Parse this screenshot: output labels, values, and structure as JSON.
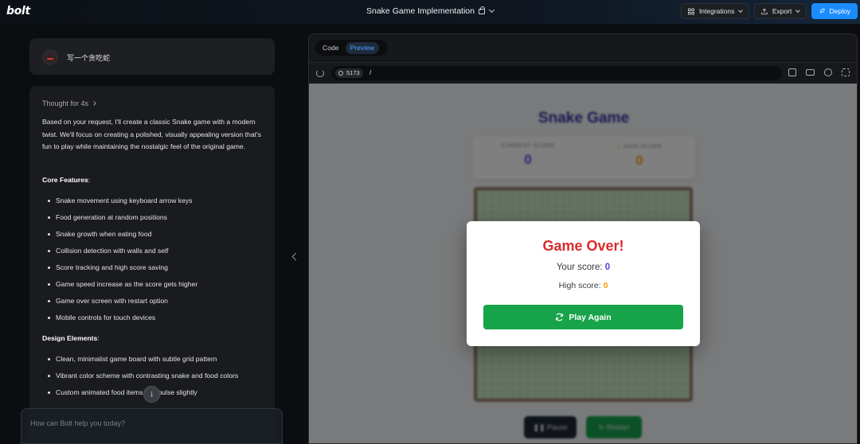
{
  "topbar": {
    "logo": "bolt",
    "project_title": "Snake Game Implementation",
    "integrations_label": "Integrations",
    "export_label": "Export",
    "deploy_label": "Deploy"
  },
  "chat": {
    "user_message": "写一个贪吃蛇",
    "thought_label": "Thought for 4s",
    "intro": "Based on your request, I'll create a classic Snake game with a modern twist. We'll focus on creating a polished, visually appealing version that's fun to play while maintaining the nostalgic feel of the original game.",
    "core_heading": "Core Features",
    "core_features": [
      "Snake movement using keyboard arrow keys",
      "Food generation at random positions",
      "Snake growth when eating food",
      "Collision detection with walls and self",
      "Score tracking and high score saving",
      "Game speed increase as the score gets higher",
      "Game over screen with restart option",
      "Mobile controls for touch devices"
    ],
    "design_heading": "Design Elements",
    "design_elements": [
      "Clean, minimalist game board with subtle grid pattern",
      "Vibrant color scheme with contrasting snake and food colors",
      "Custom animated food items that pulse slightly"
    ],
    "input_placeholder": "How can Bolt help you today?"
  },
  "preview": {
    "tabs": [
      "Code",
      "Preview"
    ],
    "active_tab": "Preview",
    "port": "5173",
    "path": "/"
  },
  "game": {
    "title": "Snake Game",
    "current_score_label": "CURRENT SCORE",
    "current_score": "0",
    "high_score_label": "HIGH SCORE",
    "high_score": "0",
    "pause_label": "Pause",
    "restart_label": "Restart",
    "modal": {
      "title": "Game Over!",
      "your_score_label": "Your score:",
      "your_score": "0",
      "high_score_label": "High score:",
      "high_score": "0",
      "play_again_label": "Play Again"
    }
  },
  "colors": {
    "accent": "#1a8cff",
    "game_over_red": "#d92b2b",
    "score_blue": "#4f46e5",
    "score_amber": "#f59e0b",
    "play_green": "#17a34a"
  }
}
